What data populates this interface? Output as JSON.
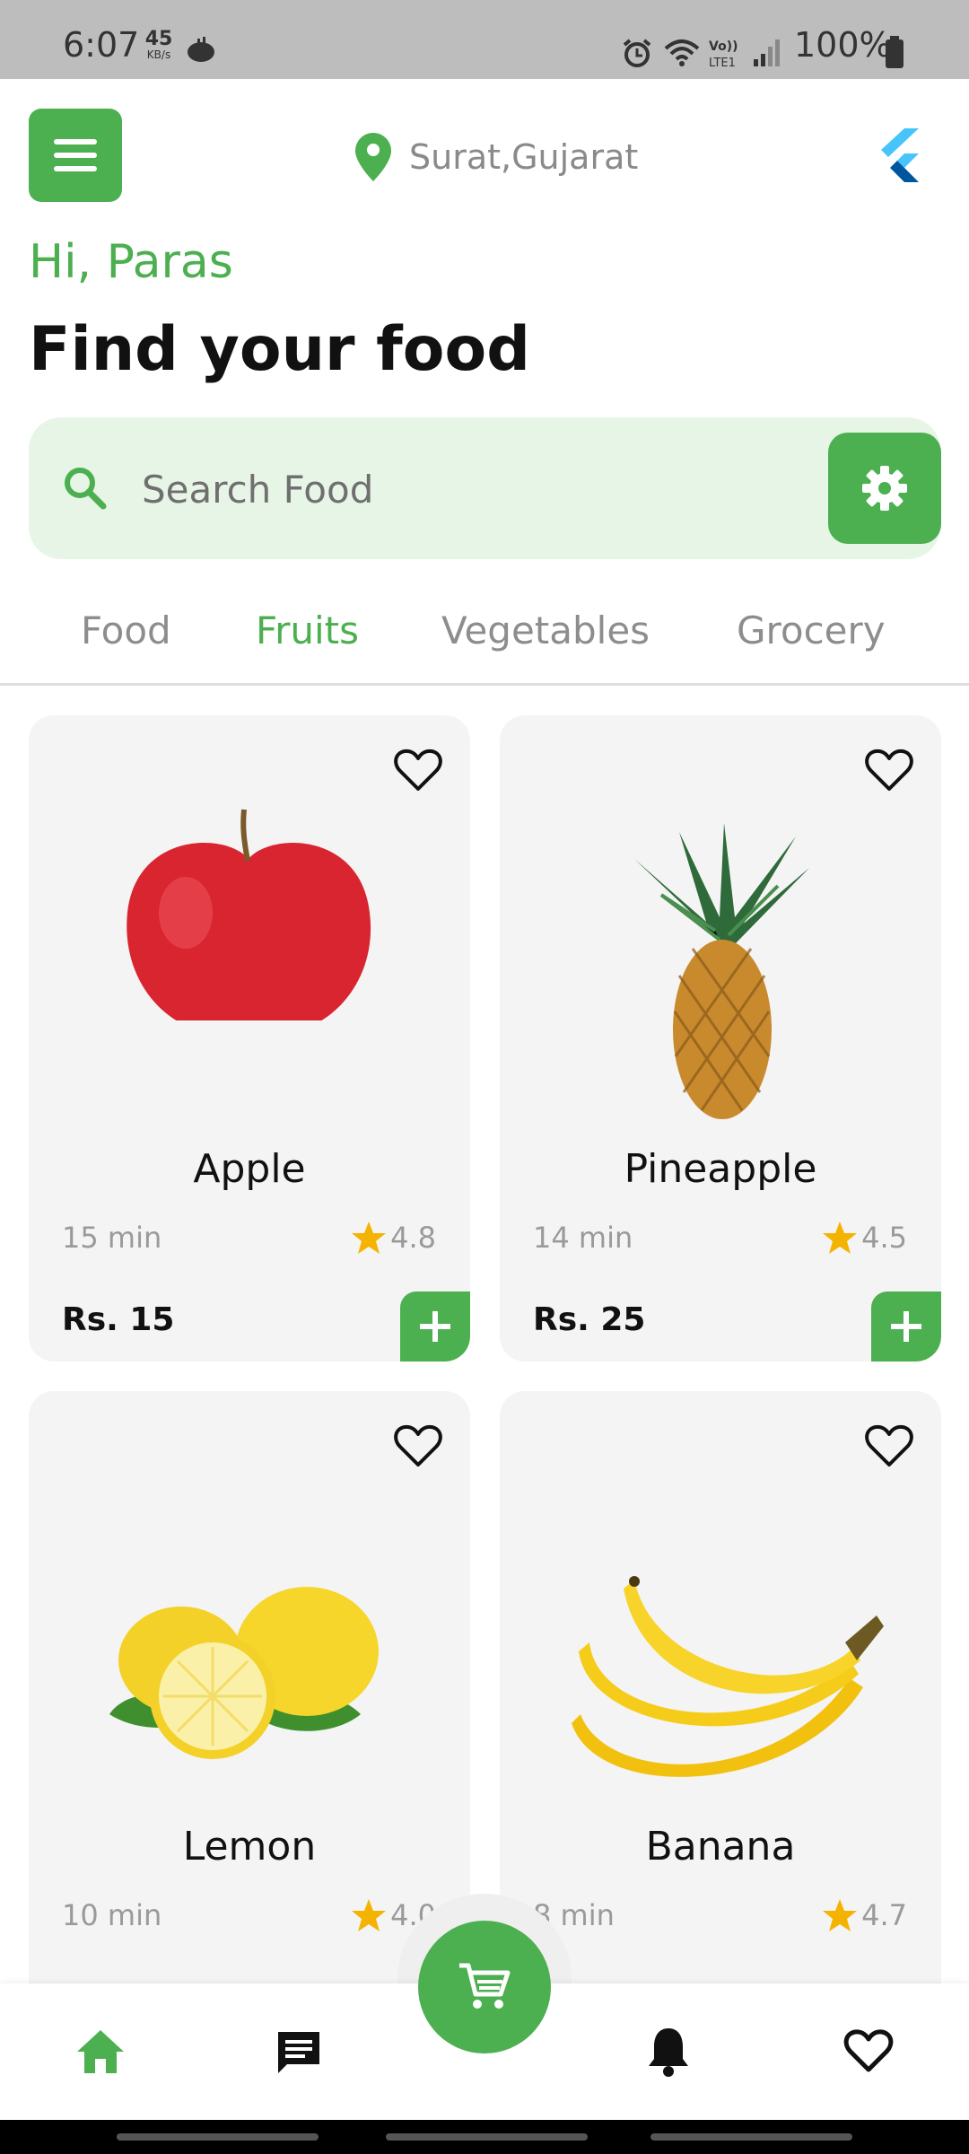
{
  "status_bar": {
    "time": "6:07",
    "speed_value": "45",
    "speed_unit": "KB/s",
    "battery_text": "100%"
  },
  "header": {
    "location": "Surat,Gujarat",
    "greeting": "Hi, Paras",
    "title": "Find your food"
  },
  "search": {
    "placeholder": "Search Food"
  },
  "tabs": [
    {
      "label": "Food",
      "active": false
    },
    {
      "label": "Fruits",
      "active": true
    },
    {
      "label": "Vegetables",
      "active": false
    },
    {
      "label": "Grocery",
      "active": false
    }
  ],
  "products": [
    {
      "name": "Apple",
      "time": "15 min",
      "rating": "4.8",
      "price": "Rs. 15",
      "image": "apple-image"
    },
    {
      "name": "Pineapple",
      "time": "14 min",
      "rating": "4.5",
      "price": "Rs. 25",
      "image": "pineapple-image"
    },
    {
      "name": "Lemon",
      "time": "10 min",
      "rating": "4.0",
      "price": "",
      "image": "lemon-image"
    },
    {
      "name": "Banana",
      "time": "8 min",
      "rating": "4.7",
      "price": "",
      "image": "banana-image"
    }
  ],
  "bottom_nav": {
    "items": [
      "home-icon",
      "chat-icon",
      "cart-icon",
      "bell-icon",
      "heart-icon"
    ]
  },
  "colors": {
    "accent": "#4caf50",
    "search_bg": "#e7f5e7",
    "card_bg": "#f4f4f4",
    "star": "#f5b301"
  }
}
